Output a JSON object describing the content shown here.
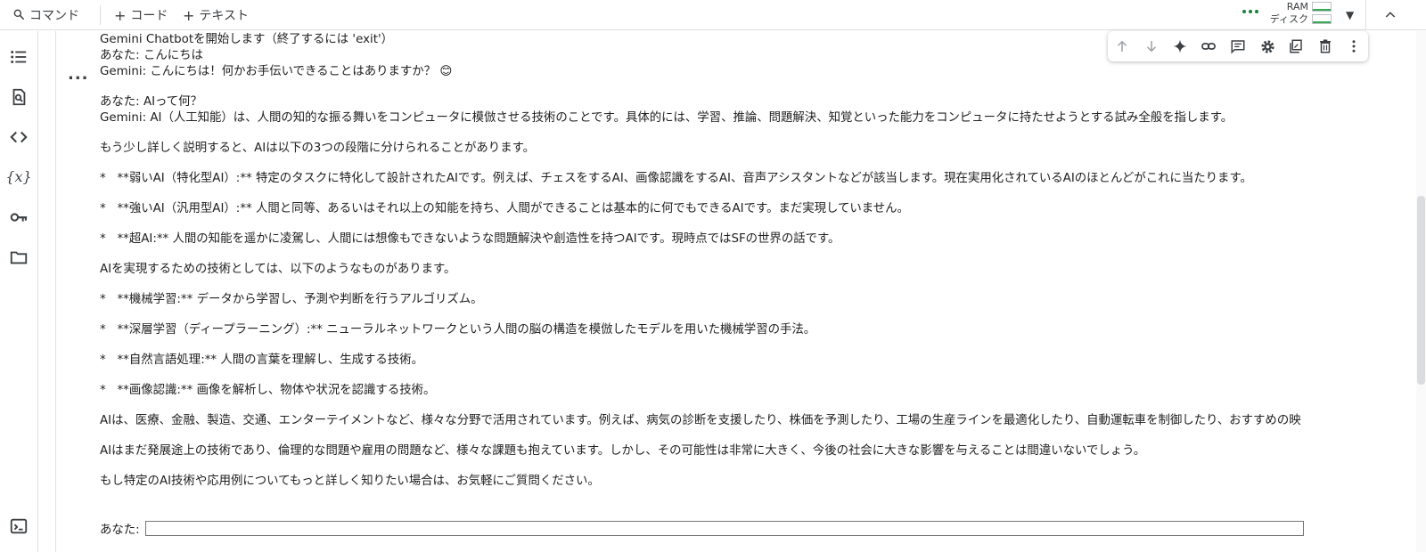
{
  "toolbar": {
    "command_label": "コマンド",
    "code_label": "コード",
    "text_label": "テキスト",
    "ram_label": "RAM",
    "disk_label": "ディスク"
  },
  "icons": {
    "search": "search-icon",
    "plus": "plus-icon",
    "caret": "caret-down-icon",
    "collapse": "chevron-up-icon"
  },
  "colors": {
    "accent": "#188038",
    "text": "#212121",
    "border": "#e0e0e0"
  },
  "output": {
    "lines": [
      "Gemini Chatbotを開始します（終了するには 'exit'）",
      "あなた: こんにちは",
      "Gemini: こんにちは！何かお手伝いできることはありますか？ 😊",
      "",
      "あなた: AIって何？",
      "Gemini: AI（人工知能）は、人間の知的な振る舞いをコンピュータに模倣させる技術のことです。具体的には、学習、推論、問題解決、知覚といった能力をコンピュータに持たせようとする試み全般を指します。",
      "",
      "もう少し詳しく説明すると、AIは以下の3つの段階に分けられることがあります。",
      "",
      "*   **弱いAI（特化型AI）:** 特定のタスクに特化して設計されたAIです。例えば、チェスをするAI、画像認識をするAI、音声アシスタントなどが該当します。現在実用化されているAIのほとんどがこれに当たります。",
      "",
      "*   **強いAI（汎用型AI）:** 人間と同等、あるいはそれ以上の知能を持ち、人間ができることは基本的に何でもできるAIです。まだ実現していません。",
      "",
      "*   **超AI:** 人間の知能を遥かに凌駕し、人間には想像もできないような問題解決や創造性を持つAIです。現時点ではSFの世界の話です。",
      "",
      "AIを実現するための技術としては、以下のようなものがあります。",
      "",
      "*   **機械学習:** データから学習し、予測や判断を行うアルゴリズム。",
      "",
      "*   **深層学習（ディープラーニング）:** ニューラルネットワークという人間の脳の構造を模倣したモデルを用いた機械学習の手法。",
      "",
      "*   **自然言語処理:** 人間の言葉を理解し、生成する技術。",
      "",
      "*   **画像認識:** 画像を解析し、物体や状況を認識する技術。",
      "",
      "AIは、医療、金融、製造、交通、エンターテイメントなど、様々な分野で活用されています。例えば、病気の診断を支援したり、株価を予測したり、工場の生産ラインを最適化したり、自動運転車を制御したり、おすすめの映",
      "",
      "AIはまだ発展途上の技術であり、倫理的な問題や雇用の問題など、様々な課題も抱えています。しかし、その可能性は非常に大きく、今後の社会に大きな影響を与えることは間違いないでしょう。",
      "",
      "もし特定のAI技術や応用例についてもっと詳しく知りたい場合は、お気軽にご質問ください。"
    ],
    "prompt_label": "あなた:",
    "input_value": ""
  }
}
